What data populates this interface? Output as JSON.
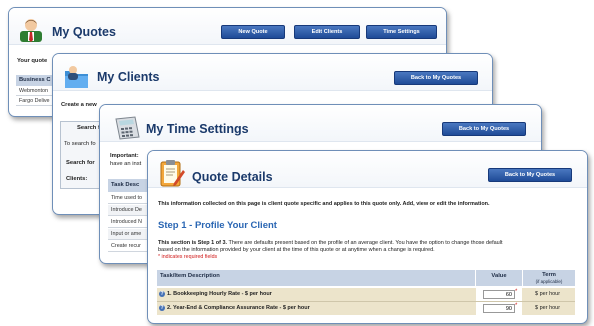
{
  "quotes": {
    "title": "My Quotes",
    "buttons": [
      "New Quote",
      "Edit Clients",
      "Time Settings"
    ],
    "intro": "Your quote",
    "col_business": "Business C",
    "rows": [
      "Webmonton",
      "Fargo Delive"
    ]
  },
  "clients": {
    "title": "My Clients",
    "back": "Back to My Quotes",
    "intro": "Create a new",
    "search_label": "Search f",
    "search_hint": "To search fo",
    "search_for": "Search for",
    "clients_label": "Clients:"
  },
  "time": {
    "title": "My Time Settings",
    "back": "Back to My Quotes",
    "important_label": "Important:",
    "important_text": "have an inst",
    "task_head": "Task Desc",
    "rows": [
      "Time used to",
      "Introduce De",
      "Introduced N",
      "Input or ame",
      "Create recur"
    ]
  },
  "details": {
    "title": "Quote Details",
    "back": "Back to My Quotes",
    "intro": "This information collected on this page is client quote specific and applies to this quote only. Add, view or edit the information.",
    "step_heading": "Step 1 - Profile Your Client",
    "section_bold": "This section is Step 1 of 3.",
    "section_text_1": " There are defaults present based on the profile of an average client. You have the option to change those default",
    "section_text_2": "based on the information provided by your client at the time of this quote or at anytime when a change is required.",
    "required_note": "* indicates required fields",
    "table": {
      "col_task": "Task/Item Description",
      "col_value": "Value",
      "col_term": "Term",
      "col_term_sub": "(if applicable)",
      "rows": [
        {
          "label": "1. Bookkeeping Hourly Rate - $ per hour",
          "value": "60",
          "term": "$ per hour"
        },
        {
          "label": "2. Year-End & Compliance Assurance Rate - $ per hour",
          "value": "90",
          "term": "$ per hour"
        }
      ]
    }
  }
}
